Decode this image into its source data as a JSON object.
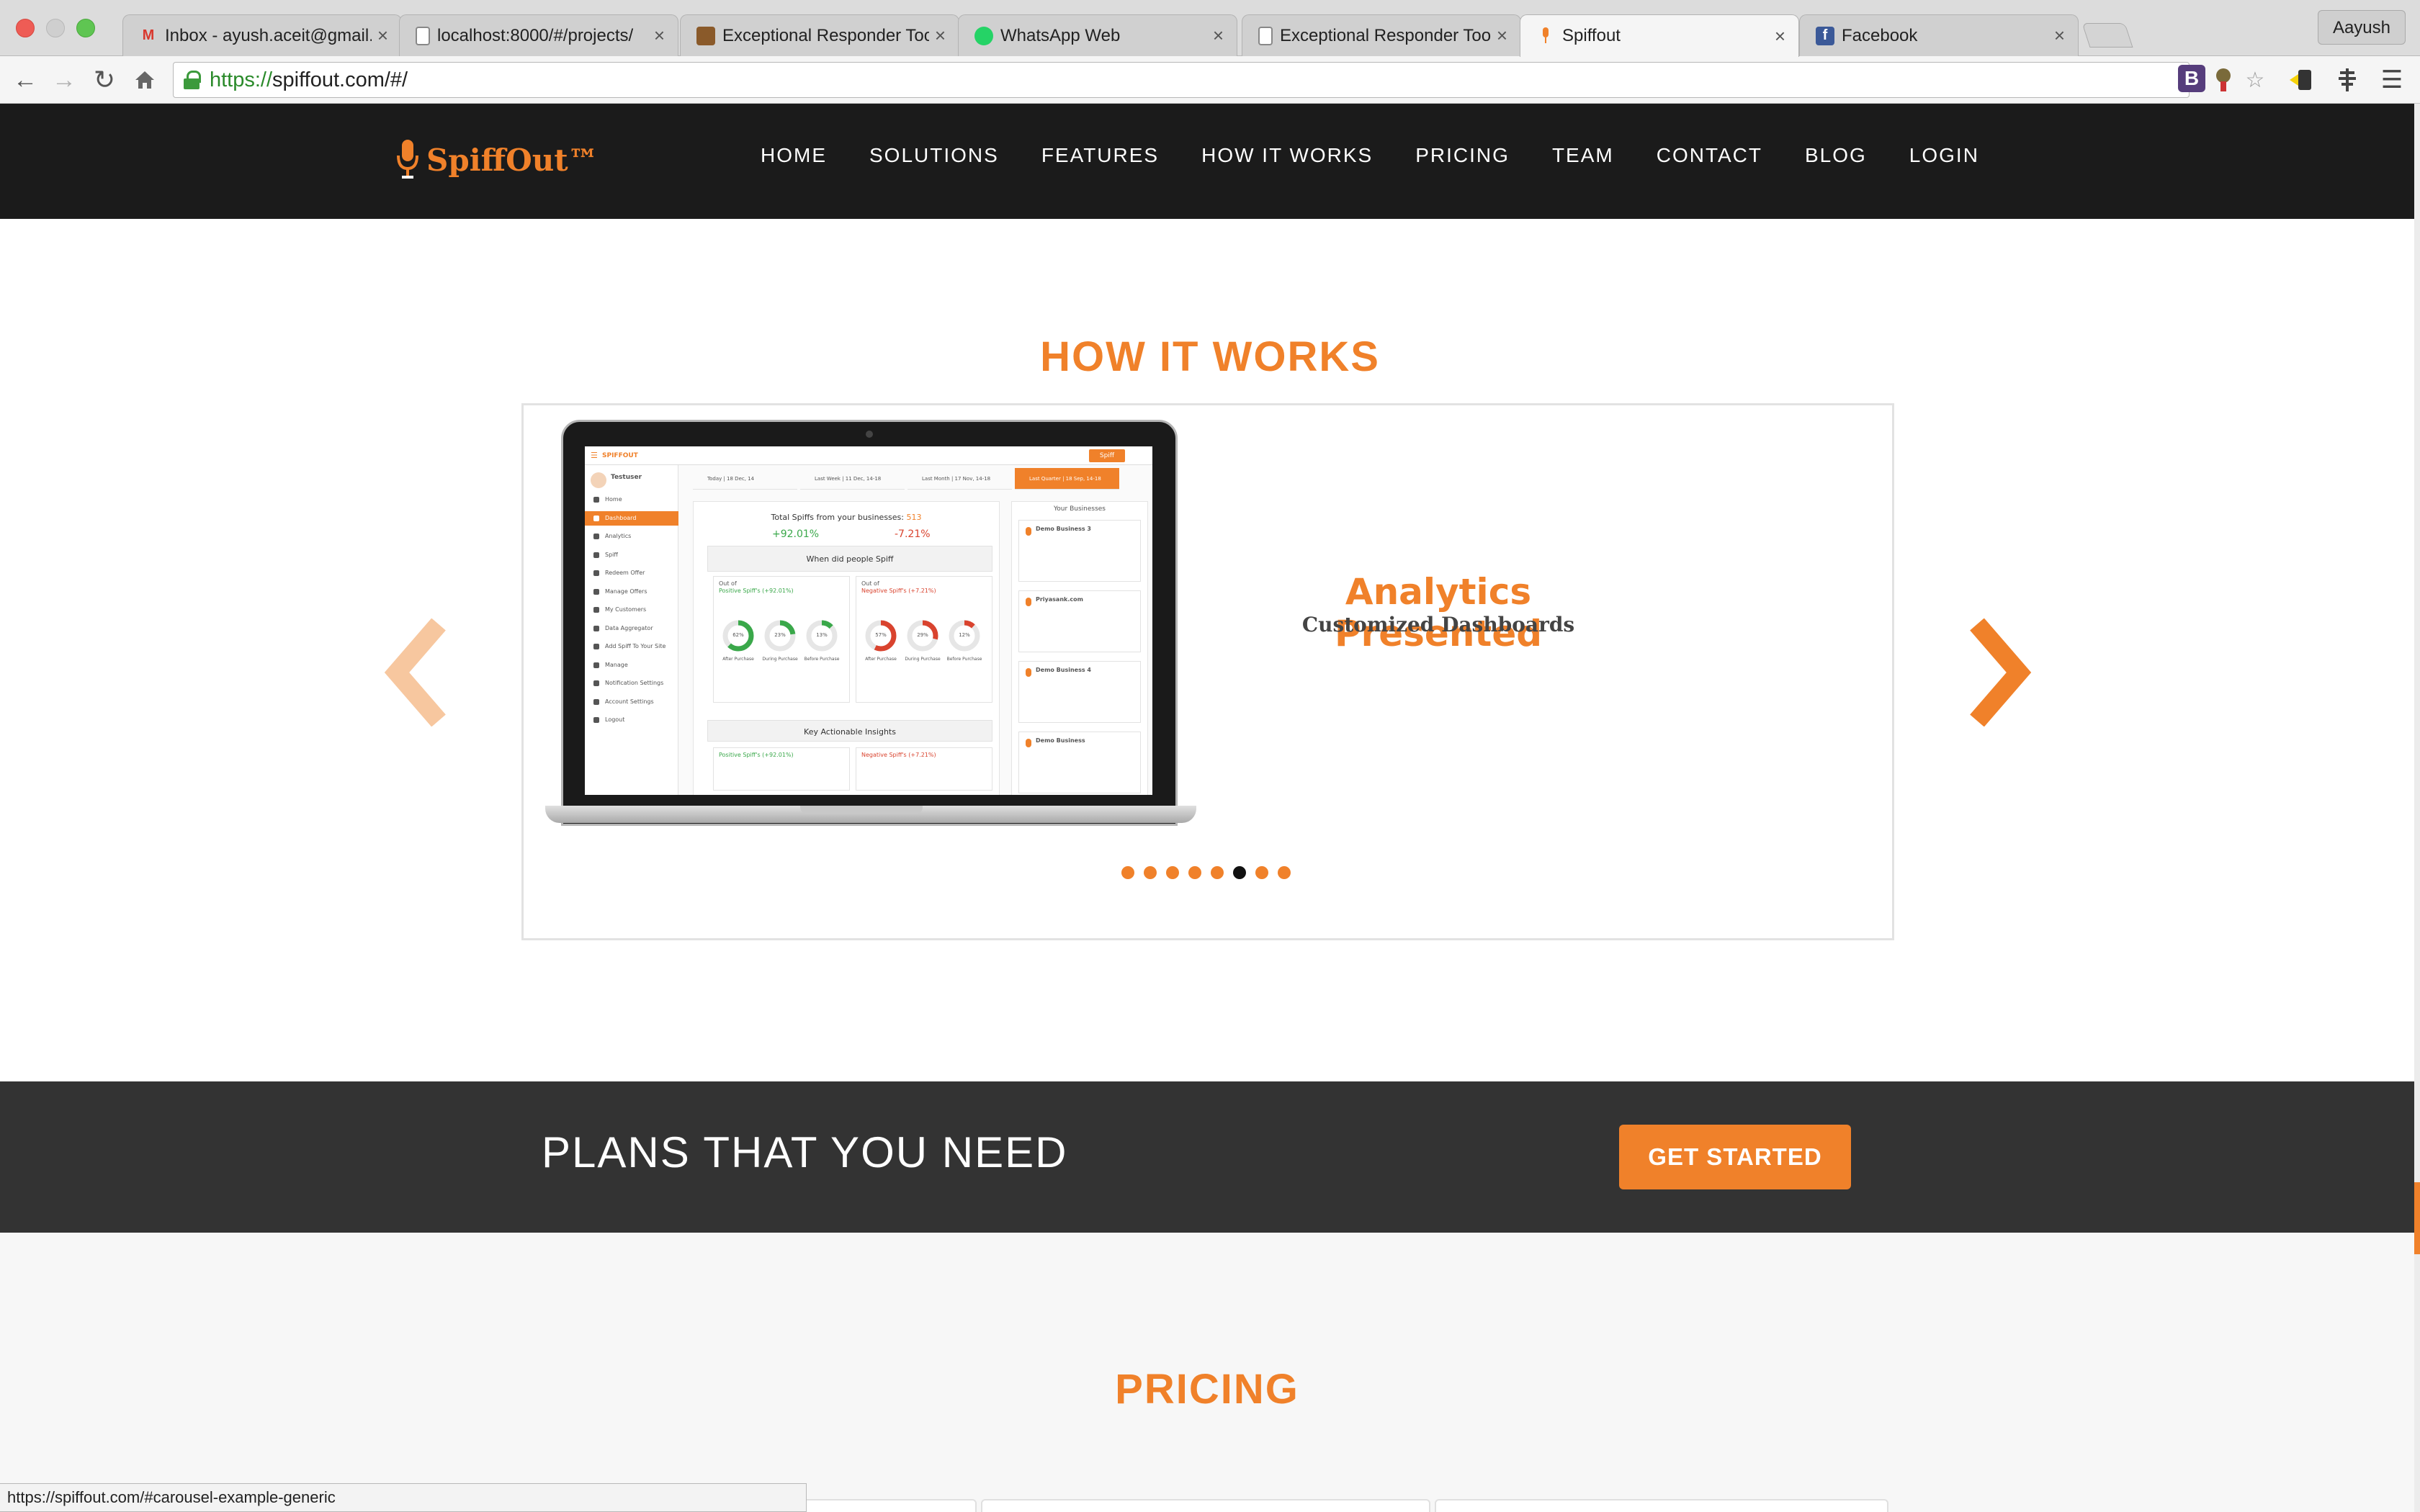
{
  "browser": {
    "tabs": [
      {
        "label": "Inbox - ayush.aceit@gmail.c",
        "favicon": "gmail-icon",
        "color": "#d9382e"
      },
      {
        "label": "localhost:8000/#/projects/",
        "favicon": "page-icon",
        "color": "#888888"
      },
      {
        "label": "Exceptional Responder Too",
        "favicon": "image-icon",
        "color": "#8a5a2a"
      },
      {
        "label": "WhatsApp Web",
        "favicon": "whatsapp-icon",
        "color": "#25d366"
      },
      {
        "label": "Exceptional Responder Too",
        "favicon": "page-icon",
        "color": "#888888"
      },
      {
        "label": "Spiffout",
        "favicon": "microphone-icon",
        "color": "#f0812a",
        "active": true
      },
      {
        "label": "Facebook",
        "favicon": "facebook-icon",
        "color": "#3b5998"
      }
    ],
    "profile_name": "Aayush",
    "url_scheme": "https://",
    "url_rest": "spiffout.com/#/",
    "status_url": "https://spiffout.com/#carousel-example-generic"
  },
  "site": {
    "logo_text": "SpiffOut™",
    "nav": [
      "HOME",
      "SOLUTIONS",
      "FEATURES",
      "HOW IT WORKS",
      "PRICING",
      "TEAM",
      "CONTACT",
      "BLOG",
      "LOGIN"
    ],
    "brand_color": "#f0812a"
  },
  "how_it_works": {
    "title": "HOW IT WORKS",
    "slide_heading": "Analytics Presented",
    "slide_subheading": "Customized Dashboards",
    "dot_count": 8,
    "active_dot": 5
  },
  "dashboard": {
    "app_name": "SPIFFOUT",
    "user_name": "Testuser",
    "user_sub": "Testuser",
    "menu": [
      "Home",
      "Dashboard",
      "Analytics",
      "Spiff",
      "Redeem Offer",
      "Manage Offers",
      "My Customers",
      "Data Aggregator",
      "Add Spiff To Your Site",
      "Manage",
      "Notification Settings",
      "Account Settings",
      "Logout"
    ],
    "filters": [
      "Today | 18 Dec, 14",
      "Last Week | 11 Dec, 14-18",
      "Last Month | 17 Nov, 14-18",
      "Last Quarter | 18 Sep, 14-18"
    ],
    "total_label": "Total Spiffs from your businesses:",
    "total_value": "513",
    "pos_pct": "+92.01%",
    "neg_pct": "-7.21%",
    "when_title": "When did people Spiff",
    "positive_label": "Positive Spiff's (+92.01%)",
    "negative_label": "Negative Spiff's (+7.21%)",
    "out_of": "Out of",
    "donuts_pos": [
      "62%",
      "23%",
      "13%"
    ],
    "donuts_neg": [
      "57%",
      "29%",
      "12%"
    ],
    "donut_captions": [
      "After Purchase",
      "During Purchase",
      "Before Purchase"
    ],
    "insights_title": "Key Actionable Insights",
    "businesses_title": "Your Businesses",
    "businesses": [
      "Demo Business 3",
      "Priyasank.com",
      "Demo Business 4",
      "Demo Business"
    ],
    "spiff_button": "Spiff"
  },
  "plans": {
    "text": "PLANS THAT YOU NEED",
    "cta": "GET STARTED"
  },
  "pricing": {
    "title": "PRICING"
  }
}
